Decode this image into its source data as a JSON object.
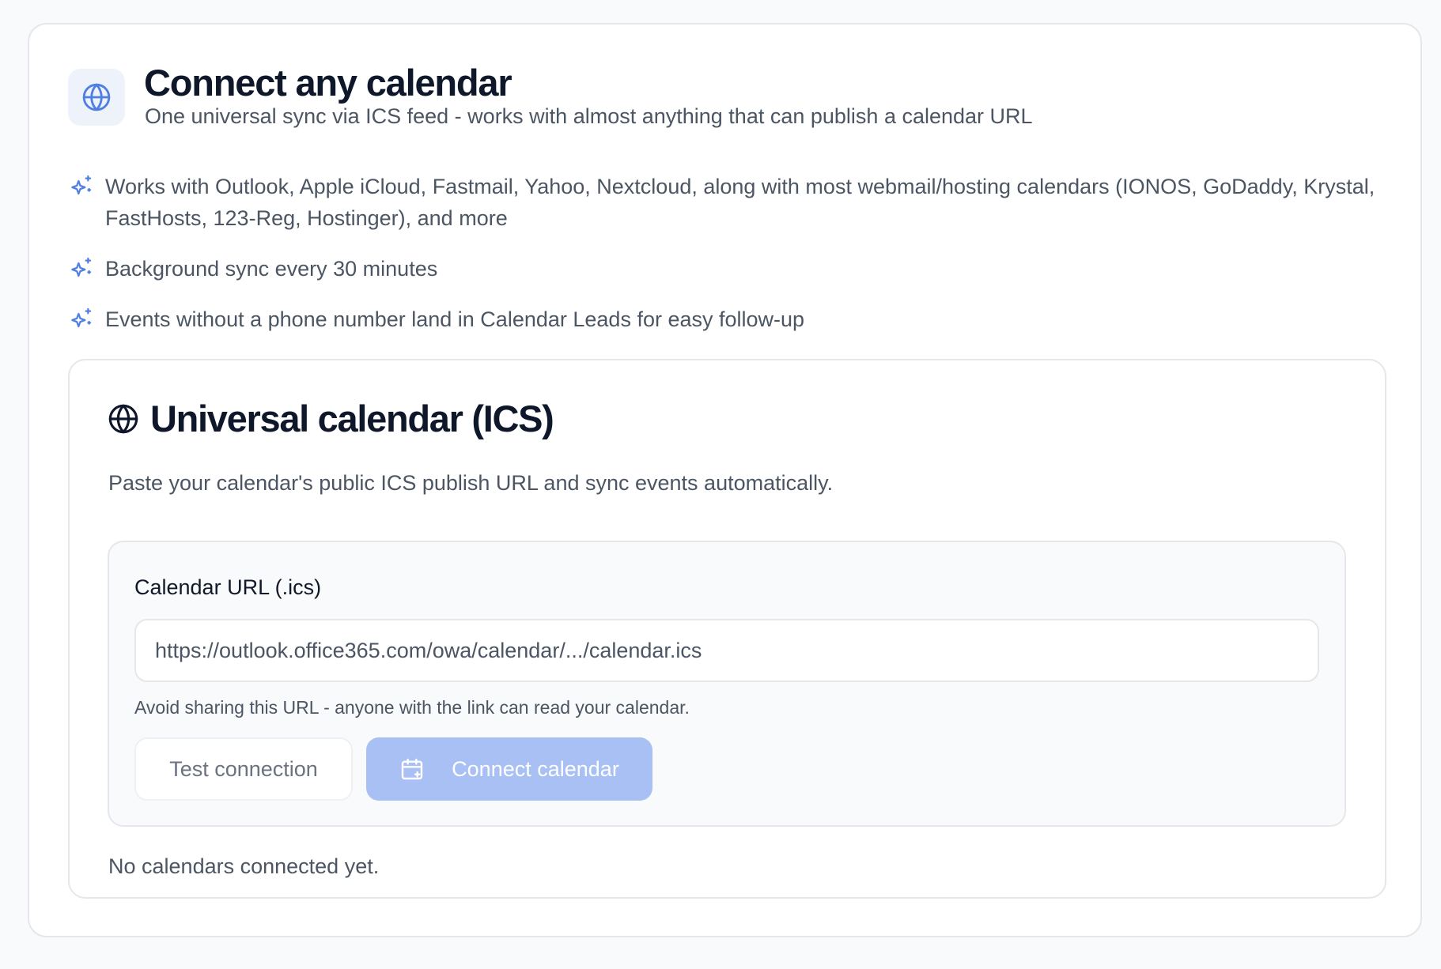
{
  "header": {
    "icon": "globe-icon",
    "title": "Connect any calendar",
    "subtitle": "One universal sync via ICS feed - works with almost anything that can publish a calendar URL"
  },
  "features": [
    {
      "icon": "sparkles-icon",
      "text": "Works with Outlook, Apple iCloud, Fastmail, Yahoo, Nextcloud, along with most webmail/hosting calendars (IONOS, GoDaddy, Krystal, FastHosts, 123-Reg, Hostinger), and more"
    },
    {
      "icon": "sparkles-icon",
      "text": "Background sync every 30 minutes"
    },
    {
      "icon": "sparkles-icon",
      "text": "Events without a phone number land in Calendar Leads for easy follow-up"
    }
  ],
  "panel": {
    "icon": "globe-icon",
    "title": "Universal calendar (ICS)",
    "description": "Paste your calendar's public ICS publish URL and sync events automatically.",
    "form": {
      "label": "Calendar URL (.ics)",
      "url_value": "",
      "url_placeholder": "https://outlook.office365.com/owa/calendar/.../calendar.ics",
      "hint": "Avoid sharing this URL - anyone with the link can read your calendar.",
      "test_button_label": "Test connection",
      "connect_button_label": "Connect calendar",
      "connect_button_icon": "calendar-plus-icon"
    },
    "empty_state": "No calendars connected yet."
  },
  "colors": {
    "accent": "#4f7fe0",
    "accent_disabled": "#a9c0f5",
    "icon_bg": "#eef2fb",
    "text_primary": "#0f172a",
    "text_secondary": "#4b5563",
    "border": "#e5e7eb"
  }
}
